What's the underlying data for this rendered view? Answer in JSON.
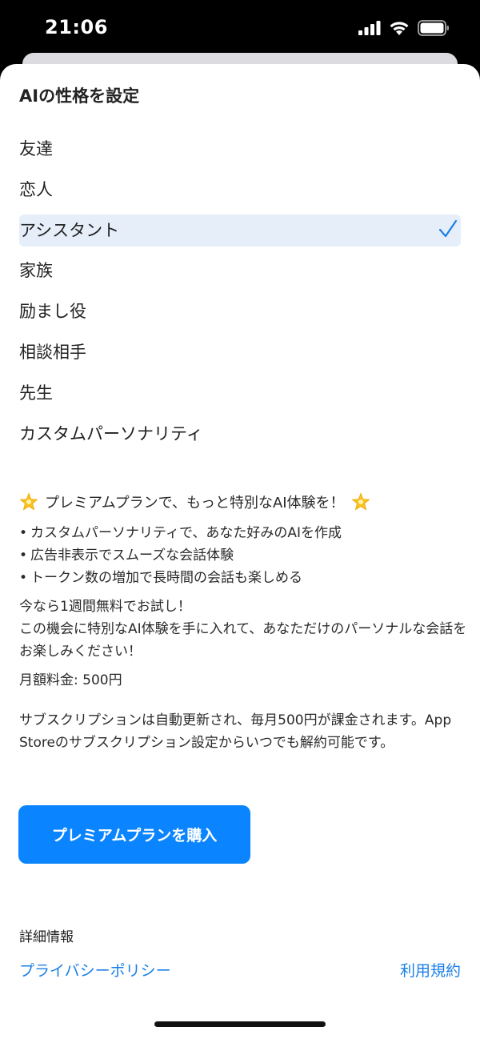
{
  "status_bar": {
    "time": "21:06"
  },
  "sheet": {
    "title": "AIの性格を設定",
    "options": [
      {
        "label": "友達",
        "selected": false
      },
      {
        "label": "恋人",
        "selected": false
      },
      {
        "label": "アシスタント",
        "selected": true
      },
      {
        "label": "家族",
        "selected": false
      },
      {
        "label": "励まし役",
        "selected": false
      },
      {
        "label": "相談相手",
        "selected": false
      },
      {
        "label": "先生",
        "selected": false
      },
      {
        "label": "カスタムパーソナリティ",
        "selected": false
      }
    ],
    "selected_color": "#e6eef9",
    "check_color": "#1a7fe8"
  },
  "promo": {
    "headline": "プレミアムプランで、もっと特別なAI体験を！",
    "benefits": [
      "カスタムパーソナリティで、あなた好みのAIを作成",
      "広告非表示でスムーズな会話体験",
      "トークン数の増加で長時間の会話も楽しめる"
    ],
    "bullet": "•",
    "trial_line1": "今なら1週間無料でお試し！",
    "trial_line2": "この機会に特別なAI体験を手に入れて、あなただけのパーソナルな会話をお楽しみください！",
    "price": "月額料金: 500円",
    "renewal_notice": "サブスクリプションは自動更新され、毎月500円が課金されます。App Storeのサブスクリプション設定からいつでも解約可能です。"
  },
  "buy_button": {
    "label": "プレミアムプランを購入",
    "color": "#0a84ff"
  },
  "details": {
    "label": "詳細情報",
    "privacy_link": "プライバシーポリシー",
    "terms_link": "利用規約",
    "link_color": "#1a7fe8"
  }
}
